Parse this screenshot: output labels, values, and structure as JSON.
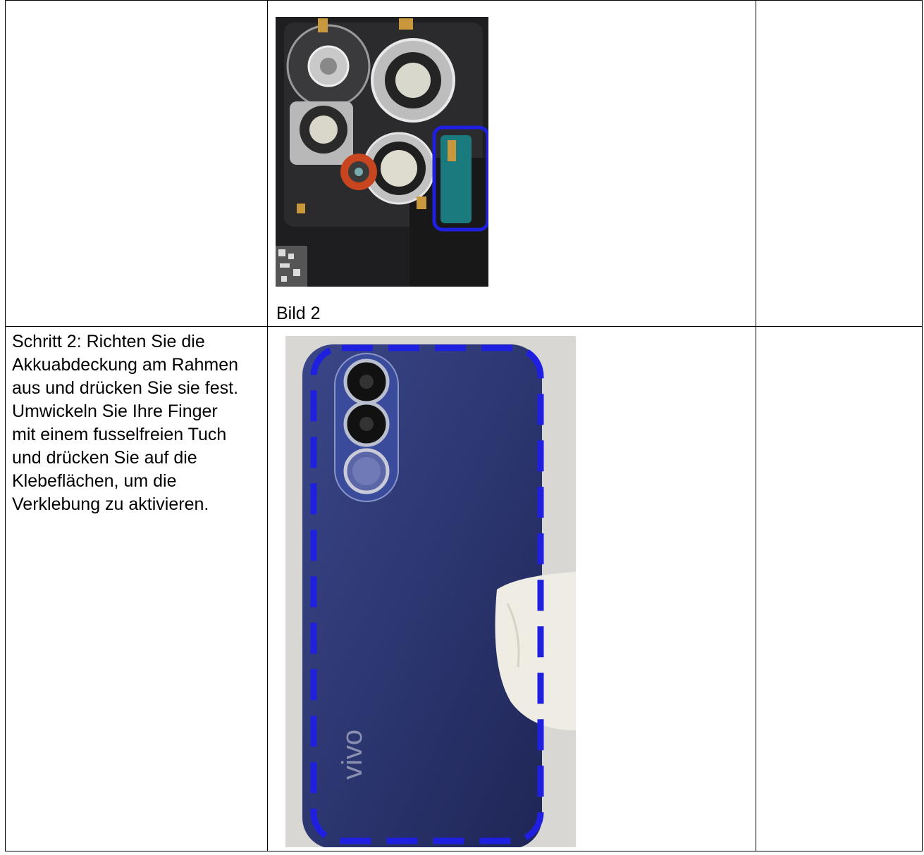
{
  "row1": {
    "caption": "Bild 2"
  },
  "row2": {
    "step_lines": [
      "Schritt 2: Richten Sie die",
      "Akkuabdeckung am Rahmen",
      "aus und drücken Sie sie fest.",
      "Umwickeln Sie Ihre Finger",
      "mit einem fusselfreien Tuch",
      "und drücken Sie auf die",
      "Klebeflächen, um die",
      "Verklebung zu aktivieren."
    ],
    "phone_brand": "vivo"
  },
  "colors": {
    "highlight_blue": "#1f1fe0",
    "phone_blue": "#2e3a78",
    "module_dark": "#2a2a2a"
  }
}
